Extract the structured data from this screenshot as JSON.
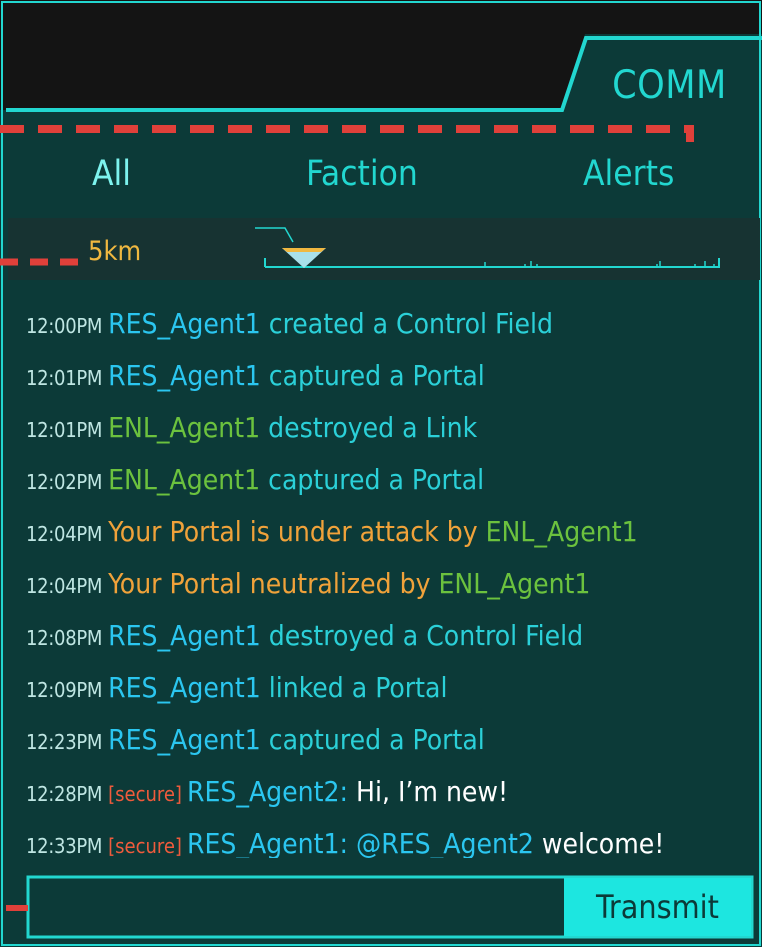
{
  "panel": {
    "title": "COMM"
  },
  "tabs": [
    {
      "label": "All",
      "active": true
    },
    {
      "label": "Faction",
      "active": false
    },
    {
      "label": "Alerts",
      "active": false
    }
  ],
  "range": {
    "label": "5km"
  },
  "messages": [
    {
      "time": "12:00PM",
      "agent": "RES_Agent1",
      "text": "created a Control Field"
    },
    {
      "time": "12:01PM",
      "agent": "RES_Agent1",
      "text": "captured a Portal"
    },
    {
      "time": "12:01PM",
      "agent": "ENL_Agent1",
      "text": "destroyed a Link"
    },
    {
      "time": "12:02PM",
      "agent": "ENL_Agent1",
      "text": "captured a Portal"
    },
    {
      "time": "12:04PM",
      "alert": "Your Portal is under attack by",
      "agent": "ENL_Agent1"
    },
    {
      "time": "12:04PM",
      "alert": "Your Portal neutralized by",
      "agent": "ENL_Agent1"
    },
    {
      "time": "12:08PM",
      "agent": "RES_Agent1",
      "text": "destroyed a Control Field"
    },
    {
      "time": "12:09PM",
      "agent": "RES_Agent1",
      "text": "linked a Portal"
    },
    {
      "time": "12:23PM",
      "agent": "RES_Agent1",
      "text": "captured a Portal"
    },
    {
      "time": "12:28PM",
      "tag": "[secure]",
      "agent": "RES_Agent2:",
      "text": "Hi, I’m new!"
    },
    {
      "time": "12:33PM",
      "tag": "[secure]",
      "agent": "RES_Agent1:",
      "mention": "@RES_Agent2",
      "text": "welcome!"
    }
  ],
  "composer": {
    "placeholder": "",
    "value": "",
    "send_label": "Transmit"
  },
  "colors": {
    "panel_bg": "#0c3a38",
    "accent": "#22d7d0",
    "resistance": "#2bc6f0",
    "enlightened": "#6cc23e",
    "alert": "#f0a23a",
    "secure": "#ef5b3c",
    "tutorial_marker": "#e0403a"
  },
  "icons": {
    "range_marker": "triangle-marker-icon"
  }
}
